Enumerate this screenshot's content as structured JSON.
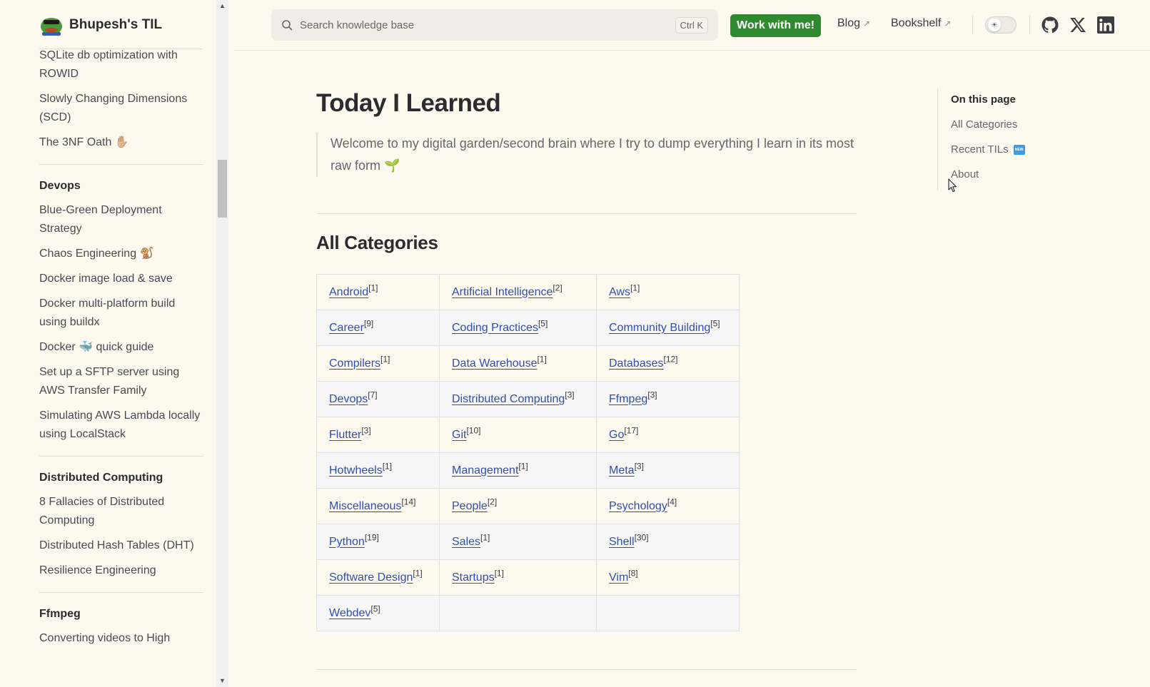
{
  "brand": {
    "title": "Bhupesh's TIL",
    "logo_icon": "pepe-frog-logo"
  },
  "sidebar": {
    "top_items": [
      "SQLite db optimization with ROWID",
      "Slowly Changing Dimensions (SCD)",
      "The 3NF Oath ✋🏼"
    ],
    "groups": [
      {
        "title": "Devops",
        "items": [
          "Blue-Green Deployment Strategy",
          "Chaos Engineering 🐒",
          "Docker image load & save",
          "Docker multi-platform build using buildx",
          "Docker 🐳 quick guide",
          "Set up a SFTP server using AWS Transfer Family",
          "Simulating AWS Lambda locally using LocalStack"
        ]
      },
      {
        "title": "Distributed Computing",
        "items": [
          "8 Fallacies of Distributed Computing",
          "Distributed Hash Tables (DHT)",
          "Resilience Engineering"
        ]
      },
      {
        "title": "Ffmpeg",
        "items": [
          "Converting videos to High"
        ]
      }
    ]
  },
  "header": {
    "search_placeholder": "Search knowledge base",
    "search_shortcut": "Ctrl K",
    "cta_label": "Work with me!",
    "nav": [
      {
        "label": "Blog",
        "ext": "↗"
      },
      {
        "label": "Bookshelf",
        "ext": "↗"
      }
    ],
    "theme_toggle_icon": "sun-icon",
    "social": [
      "github-icon",
      "x-icon",
      "linkedin-icon"
    ]
  },
  "main": {
    "title": "Today I Learned",
    "intro": "Welcome to my digital garden/second brain where I try to dump everything I learn in its most raw form 🌱",
    "section_title": "All Categories",
    "categories": [
      [
        {
          "name": "Android",
          "count": "[1]"
        },
        {
          "name": "Artificial Intelligence",
          "count": "[2]"
        },
        {
          "name": "Aws",
          "count": "[1]"
        }
      ],
      [
        {
          "name": "Career",
          "count": "[9]"
        },
        {
          "name": "Coding Practices",
          "count": "[5]"
        },
        {
          "name": "Community Building",
          "count": "[5]"
        }
      ],
      [
        {
          "name": "Compilers",
          "count": "[1]"
        },
        {
          "name": "Data Warehouse",
          "count": "[1]"
        },
        {
          "name": "Databases",
          "count": "[12]"
        }
      ],
      [
        {
          "name": "Devops",
          "count": "[7]"
        },
        {
          "name": "Distributed Computing",
          "count": "[3]"
        },
        {
          "name": "Ffmpeg",
          "count": "[3]"
        }
      ],
      [
        {
          "name": "Flutter",
          "count": "[3]"
        },
        {
          "name": "Git",
          "count": "[10]"
        },
        {
          "name": "Go",
          "count": "[17]"
        }
      ],
      [
        {
          "name": "Hotwheels",
          "count": "[1]"
        },
        {
          "name": "Management",
          "count": "[1]"
        },
        {
          "name": "Meta",
          "count": "[3]"
        }
      ],
      [
        {
          "name": "Miscellaneous",
          "count": "[14]"
        },
        {
          "name": "People",
          "count": "[2]"
        },
        {
          "name": "Psychology",
          "count": "[4]"
        }
      ],
      [
        {
          "name": "Python",
          "count": "[19]"
        },
        {
          "name": "Sales",
          "count": "[1]"
        },
        {
          "name": "Shell",
          "count": "[30]"
        }
      ],
      [
        {
          "name": "Software Design",
          "count": "[1]"
        },
        {
          "name": "Startups",
          "count": "[1]"
        },
        {
          "name": "Vim",
          "count": "[8]"
        }
      ],
      [
        {
          "name": "Webdev",
          "count": "[5]"
        },
        null,
        null
      ]
    ]
  },
  "outline": {
    "title": "On this page",
    "items": [
      {
        "label": "All Categories",
        "badge": ""
      },
      {
        "label": "Recent TILs",
        "badge": "NEW"
      },
      {
        "label": "About",
        "badge": ""
      }
    ]
  }
}
